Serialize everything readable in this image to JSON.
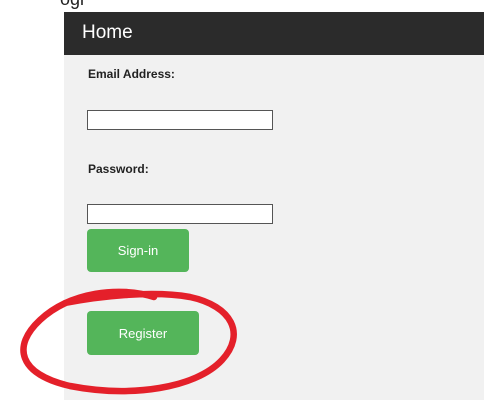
{
  "top_fragment_text": "ogi",
  "navbar": {
    "title": "Home"
  },
  "form": {
    "email_label": "Email Address:",
    "email_value": "",
    "password_label": "Password:",
    "password_value": ""
  },
  "buttons": {
    "signin_label": "Sign-in",
    "register_label": "Register"
  },
  "colors": {
    "navbar_bg": "#2b2b2b",
    "button_bg": "#54b55a",
    "form_bg": "#f1f1f1",
    "annotation": "#e4202a"
  }
}
